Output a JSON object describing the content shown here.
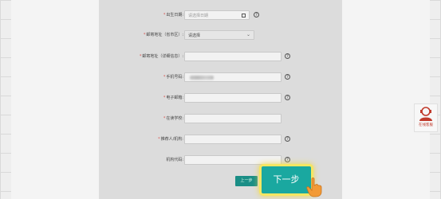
{
  "form": {
    "birth_date": {
      "label": "出生日期:",
      "placeholder": "请选择日期"
    },
    "mailing_address": {
      "label": "邮寄地址（省市区）:",
      "selected": "请选择"
    },
    "detail_address": {
      "label": "邮寄地址（详细信息）:"
    },
    "phone": {
      "label": "手机号码:"
    },
    "email": {
      "label": "电子邮箱:"
    },
    "school": {
      "label": "在读学校:"
    },
    "referrer": {
      "label": "推荐人/机构:"
    },
    "org_code": {
      "label": "机构代码:"
    }
  },
  "buttons": {
    "prev": "上一步",
    "next": "下一步"
  },
  "support": {
    "label": "在线客服"
  },
  "colors": {
    "accent": "#1aa8a0",
    "highlight": "#f5e663",
    "required": "#d9534f"
  }
}
